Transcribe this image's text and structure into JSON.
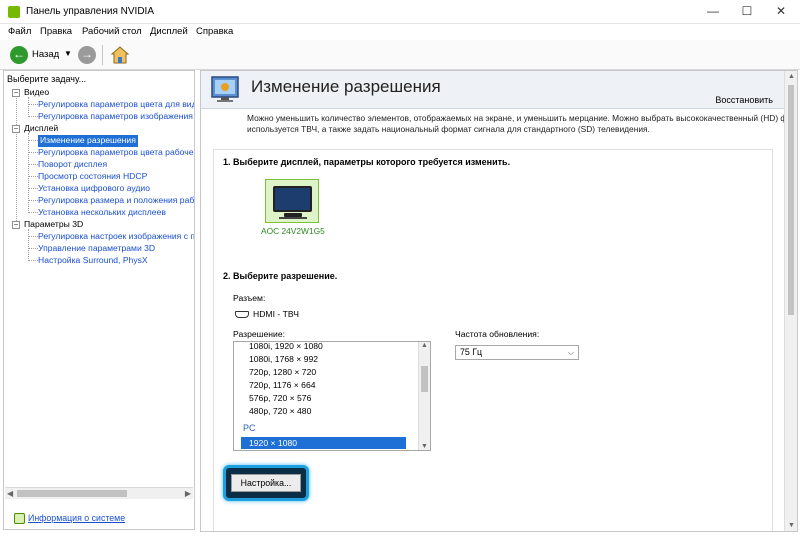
{
  "window": {
    "title": "Панель управления NVIDIA",
    "minimize": "—",
    "maximize": "☐",
    "close": "✕"
  },
  "menu": [
    "Файл",
    "Правка",
    "Рабочий стол",
    "Дисплей",
    "Справка"
  ],
  "toolbar": {
    "back_label": "Назад",
    "back_icon": "back-arrow-icon",
    "forward_icon": "forward-arrow-icon",
    "home_icon": "home-icon"
  },
  "sidebar": {
    "title": "Выберите задачу...",
    "tree": [
      {
        "label": "Видео",
        "type": "group"
      },
      {
        "label": "Регулировка параметров цвета для вид",
        "type": "leaf"
      },
      {
        "label": "Регулировка параметров изображения д",
        "type": "leaf"
      },
      {
        "label": "Дисплей",
        "type": "group"
      },
      {
        "label": "Изменение разрешения",
        "type": "leaf",
        "selected": true
      },
      {
        "label": "Регулировка параметров цвета рабочег",
        "type": "leaf"
      },
      {
        "label": "Поворот дисплея",
        "type": "leaf"
      },
      {
        "label": "Просмотр состояния HDCP",
        "type": "leaf"
      },
      {
        "label": "Установка цифрового аудио",
        "type": "leaf"
      },
      {
        "label": "Регулировка размера и положения рабоч",
        "type": "leaf"
      },
      {
        "label": "Установка нескольких дисплеев",
        "type": "leaf"
      },
      {
        "label": "Параметры 3D",
        "type": "group"
      },
      {
        "label": "Регулировка настроек изображения с пр",
        "type": "leaf"
      },
      {
        "label": "Управление параметрами 3D",
        "type": "leaf"
      },
      {
        "label": "Настройка Surround, PhysX",
        "type": "leaf"
      }
    ],
    "system_info_link": "Информация о системе"
  },
  "content": {
    "page_title": "Изменение разрешения",
    "restore_link": "Восстановить",
    "description_line1": "Можно уменьшить количество элементов, отображаемых на экране, и уменьшить мерцание. Можно выбрать высококачественный (HD) ф",
    "description_line2": "используется ТВЧ, а также задать национальный формат сигнала для стандартного (SD) телевидения.",
    "step1_label": "1. Выберите дисплей, параметры которого требуется изменить.",
    "display_name": "AOC 24V2W1G5",
    "step2_label": "2. Выберите разрешение.",
    "connector_label": "Разъем:",
    "connector_value": "HDMI - ТВЧ",
    "resolution_label": "Разрешение:",
    "resolutions_top": [
      "1080i, 1920 × 1080",
      "1080i, 1768 × 992",
      "720p, 1280 × 720",
      "720p, 1176 × 664",
      "576p, 720 × 576",
      "480p, 720 × 480"
    ],
    "pc_group_label": "PC",
    "selected_resolution": "1920 × 1080",
    "refresh_label": "Частота обновления:",
    "refresh_value": "75 Гц",
    "customize_button": "Настройка..."
  },
  "colors": {
    "accent": "#1e6fd6",
    "link": "#1a4fd1",
    "nvidia_green": "#76b900",
    "highlight_glow": "#1e9fe0"
  }
}
